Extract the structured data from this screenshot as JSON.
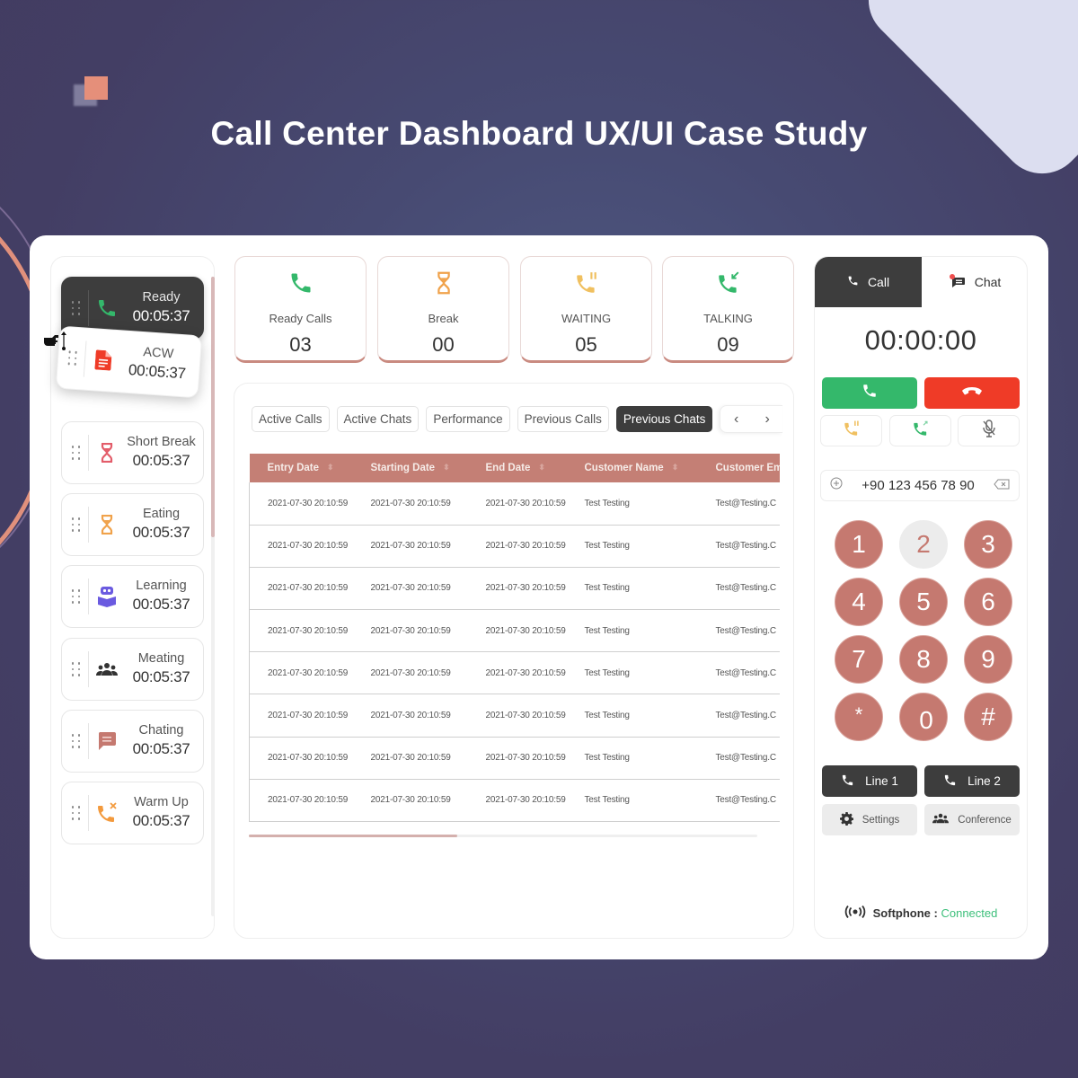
{
  "header": {
    "title": "Call Center Dashboard UX/UI Case Study"
  },
  "sidebar": {
    "statuses": [
      {
        "label": "Ready",
        "time": "00:05:37",
        "icon": "phone-icon",
        "color": "#34b86b",
        "state": "active"
      },
      {
        "label": "ACW",
        "time": "00:05:37",
        "icon": "document-icon",
        "color": "#ef3b27",
        "state": "dragging"
      },
      {
        "label": "Short Break",
        "time": "00:05:37",
        "icon": "hourglass-icon",
        "color": "#e35d6a"
      },
      {
        "label": "Eating",
        "time": "00:05:37",
        "icon": "hourglass-icon",
        "color": "#f0a24b"
      },
      {
        "label": "Learning",
        "time": "00:05:37",
        "icon": "robot-book-icon",
        "color": "#6a5ae0"
      },
      {
        "label": "Meating",
        "time": "00:05:37",
        "icon": "group-icon",
        "color": "#333333"
      },
      {
        "label": "Chating",
        "time": "00:05:37",
        "icon": "chat-bubble-icon",
        "color": "#c57970"
      },
      {
        "label": "Warm Up",
        "time": "00:05:37",
        "icon": "phone-missed-icon",
        "color": "#f39a3d"
      }
    ]
  },
  "stats": [
    {
      "label": "Ready Calls",
      "value": "03",
      "icon": "phone-icon",
      "color": "#34b86b"
    },
    {
      "label": "Break",
      "value": "00",
      "icon": "hourglass-icon",
      "color": "#f0a24b"
    },
    {
      "label": "WAITING",
      "value": "05",
      "icon": "phone-paused-icon",
      "color": "#f0c060"
    },
    {
      "label": "TALKING",
      "value": "09",
      "icon": "phone-incoming-icon",
      "color": "#34b86b"
    }
  ],
  "tabs": {
    "items": [
      "Active Calls",
      "Active Chats",
      "Performance",
      "Previous Calls",
      "Previous Chats"
    ],
    "active": "Previous Chats",
    "prev": "‹",
    "next": "›"
  },
  "table": {
    "columns": [
      "Entry Date",
      "Starting Date",
      "End Date",
      "Customer Name",
      "Customer Email"
    ],
    "rows": [
      [
        "2021-07-30  20:10:59",
        "2021-07-30  20:10:59",
        "2021-07-30  20:10:59",
        "Test Testing",
        "Test@Testing.C"
      ],
      [
        "2021-07-30  20:10:59",
        "2021-07-30  20:10:59",
        "2021-07-30  20:10:59",
        "Test Testing",
        "Test@Testing.C"
      ],
      [
        "2021-07-30  20:10:59",
        "2021-07-30  20:10:59",
        "2021-07-30  20:10:59",
        "Test Testing",
        "Test@Testing.C"
      ],
      [
        "2021-07-30  20:10:59",
        "2021-07-30  20:10:59",
        "2021-07-30  20:10:59",
        "Test Testing",
        "Test@Testing.C"
      ],
      [
        "2021-07-30  20:10:59",
        "2021-07-30  20:10:59",
        "2021-07-30  20:10:59",
        "Test Testing",
        "Test@Testing.C"
      ],
      [
        "2021-07-30  20:10:59",
        "2021-07-30  20:10:59",
        "2021-07-30  20:10:59",
        "Test Testing",
        "Test@Testing.C"
      ],
      [
        "2021-07-30  20:10:59",
        "2021-07-30  20:10:59",
        "2021-07-30  20:10:59",
        "Test Testing",
        "Test@Testing.C"
      ],
      [
        "2021-07-30  20:10:59",
        "2021-07-30  20:10:59",
        "2021-07-30  20:10:59",
        "Test Testing",
        "Test@Testing.C"
      ]
    ],
    "horizontal_scroll_fraction": 0.41
  },
  "phone": {
    "tabs": {
      "call": "Call",
      "chat": "Chat",
      "active": "Call",
      "chat_unread": true
    },
    "timer": "00:00:00",
    "number": "+90 123 456 78 90",
    "keys": [
      "1",
      "2",
      "3",
      "4",
      "5",
      "6",
      "7",
      "8",
      "9",
      "*",
      "0",
      "#"
    ],
    "pressed_key": "2",
    "line1": "Line 1",
    "line2": "Line 2",
    "settings": "Settings",
    "conference": "Conference",
    "softphone_label": "Softphone :",
    "softphone_status": "Connected"
  },
  "colors": {
    "accent": "#c57970",
    "dark": "#3d3d3d",
    "green": "#34b86b",
    "red": "#ef3b27",
    "background": "#443f65"
  }
}
